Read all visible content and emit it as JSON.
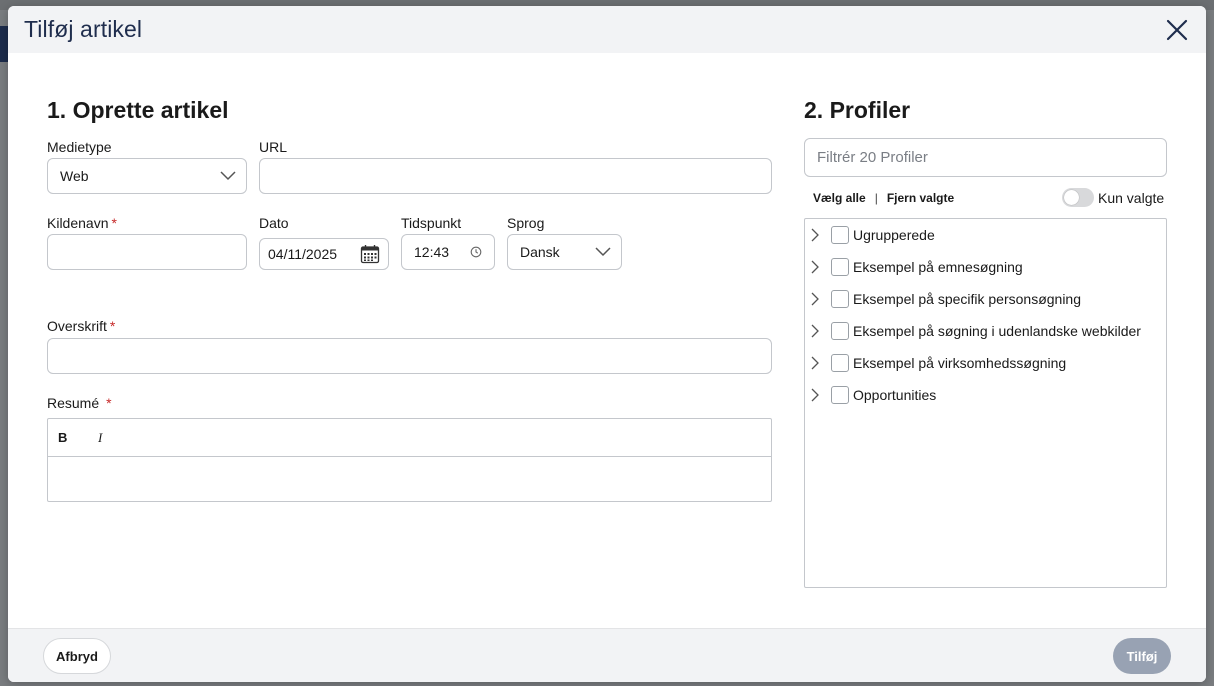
{
  "modal": {
    "title": "Tilføj artikel"
  },
  "create": {
    "section_title": "1. Oprette artikel",
    "medietype_label": "Medietype",
    "medietype_value": "Web",
    "url_label": "URL",
    "url_value": "",
    "kildenavn_label": "Kildenavn",
    "kildenavn_value": "",
    "dato_label": "Dato",
    "dato_value": "04/11/2025",
    "tidspunkt_label": "Tidspunkt",
    "tidspunkt_value": "12:43",
    "sprog_label": "Sprog",
    "sprog_value": "Dansk",
    "overskrift_label": "Overskrift",
    "overskrift_value": "",
    "resume_label": "Resumé",
    "bold_label": "B",
    "italic_label": "I",
    "required_marker": "*"
  },
  "profiles": {
    "section_title": "2. Profiler",
    "filter_placeholder": "Filtrér 20 Profiler",
    "select_all": "Vælg alle",
    "separator": "|",
    "clear_selected": "Fjern valgte",
    "only_selected_label": "Kun valgte",
    "only_selected_on": false,
    "items": [
      {
        "label": "Ugrupperede",
        "checked": false
      },
      {
        "label": "Eksempel på emnesøgning",
        "checked": false
      },
      {
        "label": "Eksempel på specifik personsøgning",
        "checked": false
      },
      {
        "label": "Eksempel på søgning i udenlandske webkilder",
        "checked": false
      },
      {
        "label": "Eksempel på virksomhedssøgning",
        "checked": false
      },
      {
        "label": "Opportunities",
        "checked": false
      }
    ]
  },
  "footer": {
    "cancel_label": "Afbryd",
    "add_label": "Tilføj"
  },
  "colors": {
    "title_navy": "#1f2d4d",
    "required_red": "#c62828",
    "add_button_disabled": "#98a2b3",
    "header_bg": "#f2f3f5"
  }
}
